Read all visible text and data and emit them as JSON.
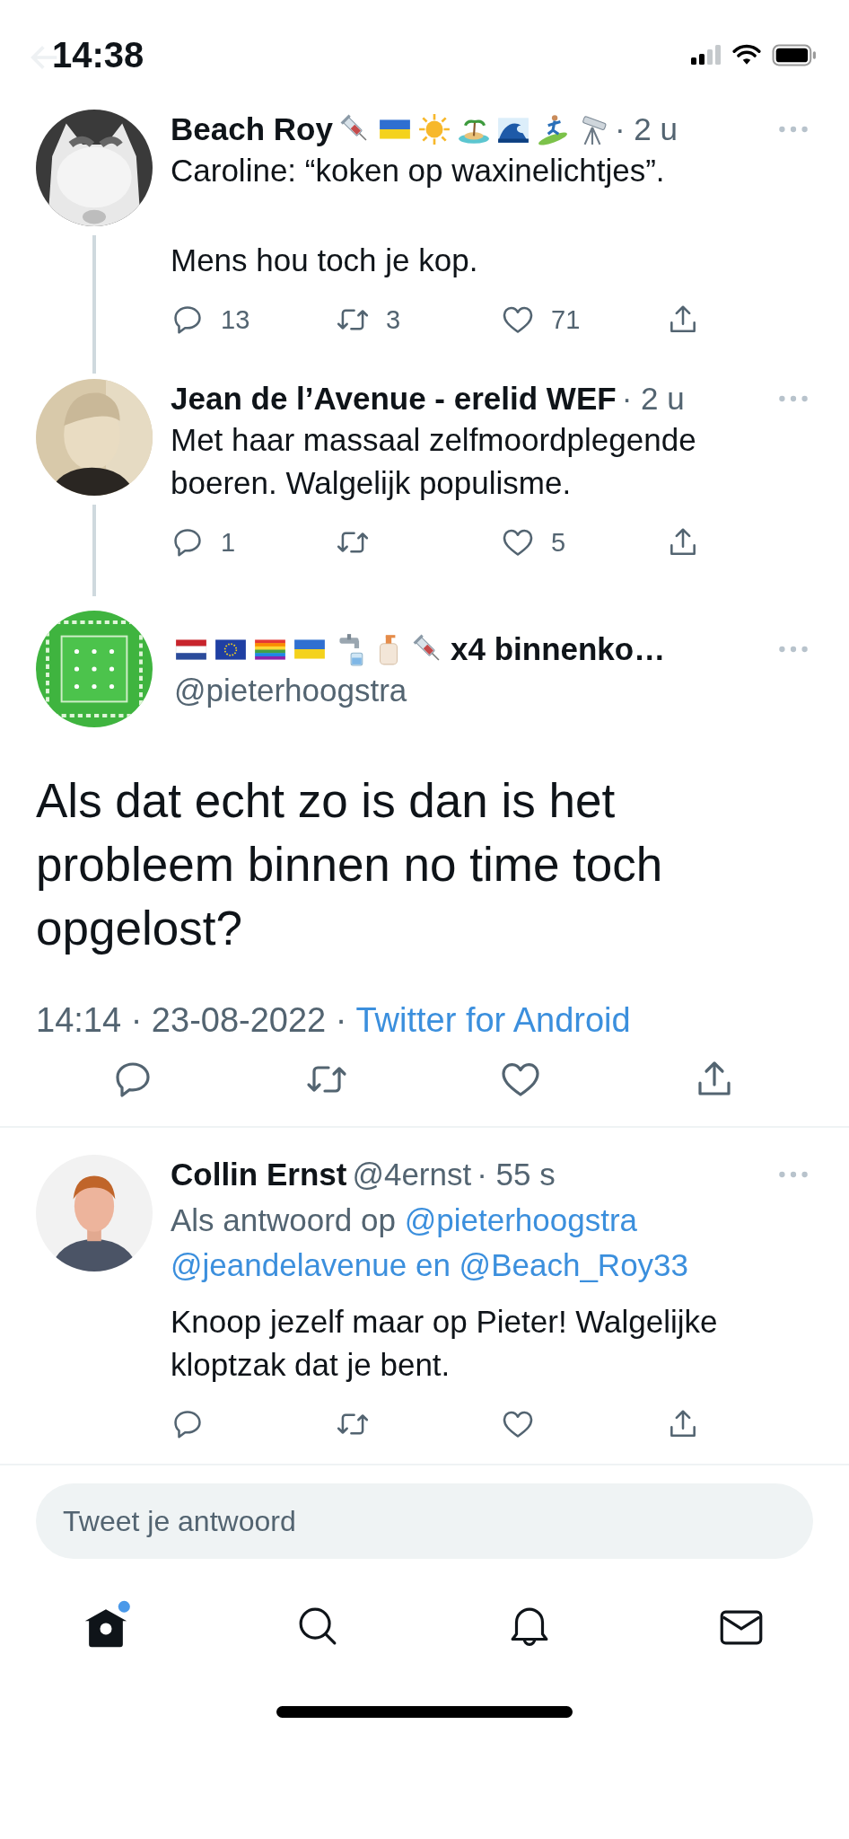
{
  "status_bar": {
    "time": "14:38"
  },
  "thread": [
    {
      "name": "Beach Roy",
      "badges": [
        {
          "kind": "syringe"
        },
        {
          "kind": "flag-ukraine"
        },
        {
          "kind": "sun"
        },
        {
          "kind": "island"
        },
        {
          "kind": "wave"
        },
        {
          "kind": "surfer"
        },
        {
          "kind": "telescope"
        }
      ],
      "time": "· 2 u",
      "paragraphs": [
        "Caroline: “koken op waxinelichtjes”.",
        "Mens hou toch je kop."
      ],
      "replies": "13",
      "retweets": "3",
      "likes": "71"
    },
    {
      "name": "Jean de l’Avenue - erelid WEF",
      "time": "· 2 u",
      "paragraphs": [
        "Met haar massaal zelfmoordplegende boeren. Walgelijk populisme."
      ],
      "replies": "1",
      "likes": "5"
    }
  ],
  "main_tweet": {
    "badges": [
      {
        "kind": "flag-netherlands"
      },
      {
        "kind": "flag-eu"
      },
      {
        "kind": "flag-rainbow"
      },
      {
        "kind": "flag-ukraine"
      },
      {
        "kind": "faucet"
      },
      {
        "kind": "soap"
      },
      {
        "kind": "syringe"
      }
    ],
    "name": "x4 binnenko…",
    "handle": "@pieterhoogstra",
    "text": "Als dat echt zo is dan is het probleem binnen no time toch opgelost?",
    "meta": "14:14 · 23-08-2022 ·",
    "source": "Twitter for Android"
  },
  "replies": [
    {
      "name": "Collin Ernst",
      "handle": "@4ernst",
      "time": "· 55 s",
      "reply_prefix": "Als antwoord op",
      "mentions": [
        "@pieterhoogstra",
        "@jeandelavenue en @Beach_Roy33"
      ],
      "text": "Knoop jezelf maar op Pieter! Walgelijke kloptzak dat je bent."
    }
  ],
  "composer": {
    "placeholder": "Tweet je antwoord"
  },
  "nav": [
    {
      "kind": "home",
      "selected": true,
      "unread": true
    },
    {
      "kind": "search",
      "selected": false,
      "unread": false
    },
    {
      "kind": "bell",
      "selected": false,
      "unread": false
    },
    {
      "kind": "mail",
      "selected": false,
      "unread": false
    }
  ]
}
